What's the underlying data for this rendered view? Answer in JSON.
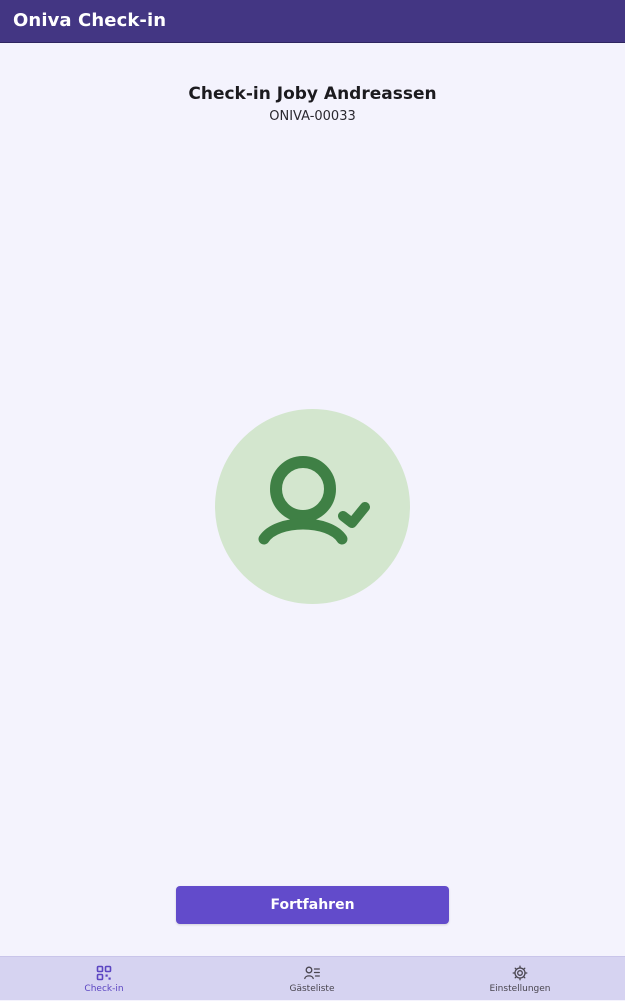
{
  "app_bar": {
    "title": "Oniva Check-in"
  },
  "checkin": {
    "title": "Check-in Joby Andreassen",
    "guest_code": "ONIVA-00033",
    "status_icon": "person-check-icon",
    "continue_label": "Fortfahren"
  },
  "bottom_nav": {
    "items": [
      {
        "label": "Check-in",
        "icon": "qr-code-icon",
        "active": true
      },
      {
        "label": "Gästeliste",
        "icon": "guest-list-icon",
        "active": false
      },
      {
        "label": "Einstellungen",
        "icon": "gear-icon",
        "active": false
      }
    ]
  },
  "colors": {
    "app_bar": "#433683",
    "background": "#f4f3fd",
    "primary_button": "#624bcb",
    "success_circle": "#d3e6ce",
    "success_icon": "#3f8045",
    "bottom_nav": "#d6d3f1",
    "active_nav": "#5b45c2"
  }
}
